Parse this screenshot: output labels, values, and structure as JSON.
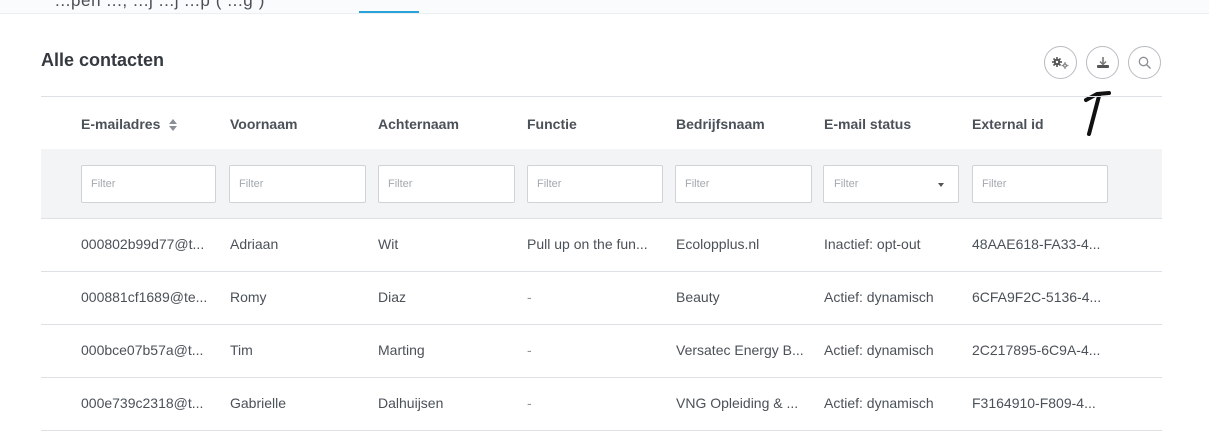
{
  "topbar": {
    "partial_text": "...pen              ...,                 ...j                              ...j      ...p             (          ...g  )"
  },
  "card": {
    "title": "Alle contacten"
  },
  "toolbar": {
    "icons": [
      "gears-icon",
      "download-icon",
      "search-icon"
    ]
  },
  "table": {
    "columns": [
      "E-mailadres",
      "Voornaam",
      "Achternaam",
      "Functie",
      "Bedrijfsnaam",
      "E-mail status",
      "External id"
    ],
    "filter_placeholder": "Filter",
    "rows": [
      [
        "000802b99d77@t...",
        "Adriaan",
        "Wit",
        "Pull up on the fun...",
        "Ecolopplus.nl",
        "Inactief: opt-out",
        "48AAE618-FA33-4..."
      ],
      [
        "000881cf1689@te...",
        "Romy",
        "Diaz",
        "-",
        "Beauty",
        "Actief: dynamisch",
        "6CFA9F2C-5136-4..."
      ],
      [
        "000bce07b57a@t...",
        "Tim",
        "Marting",
        "-",
        "Versatec Energy B...",
        "Actief: dynamisch",
        "2C217895-6C9A-4..."
      ],
      [
        "000e739c2318@t...",
        "Gabrielle",
        "Dalhuijsen",
        "-",
        "VNG Opleiding & ...",
        "Actief: dynamisch",
        "F3164910-F809-4..."
      ]
    ]
  },
  "colors": {
    "accent": "#2aa3d9",
    "border": "#dde1e5",
    "filter_row_bg": "#f3f4f6"
  }
}
